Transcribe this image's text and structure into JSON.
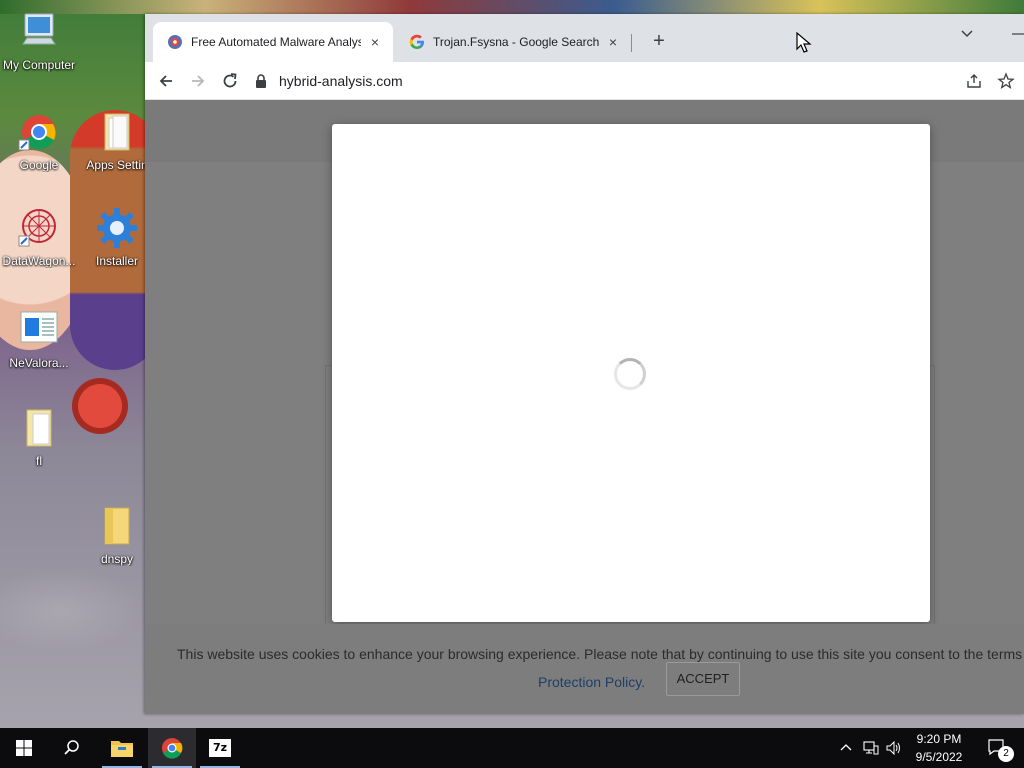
{
  "desktop": {
    "icons": [
      {
        "label": "My Computer"
      },
      {
        "label": "Google"
      },
      {
        "label": "Apps Settin"
      },
      {
        "label": "DataWagon..."
      },
      {
        "label": "Installer"
      },
      {
        "label": "NeValora..."
      },
      {
        "label": "fl"
      },
      {
        "label": "dnspy"
      }
    ]
  },
  "browser": {
    "tabs": [
      {
        "title": "Free Automated Malware Analys",
        "close": "×",
        "favicon": "hybrid-analysis-favicon"
      },
      {
        "title": "Trojan.Fsysna - Google Search",
        "close": "×",
        "favicon": "google-g-favicon"
      }
    ],
    "new_tab": "+",
    "url": "hybrid-analysis.com",
    "modal": {
      "state": "loading"
    },
    "cookie_banner": {
      "message": "This website uses cookies to enhance your browsing experience. Please note that by continuing to use this site you consent to the terms",
      "link": "Protection Policy.",
      "accept": "ACCEPT"
    }
  },
  "taskbar": {
    "items": [
      "start",
      "search",
      "file-explorer",
      "chrome",
      "7zip"
    ],
    "sevenzip_label": "7z",
    "time": "9:20 PM",
    "date": "9/5/2022",
    "notifications": "2"
  },
  "colors": {
    "tabstrip": "#dee1e6",
    "overlay": "#7f7f7f",
    "link": "#1e3f6a",
    "taskbar": "#0c0c0f"
  }
}
